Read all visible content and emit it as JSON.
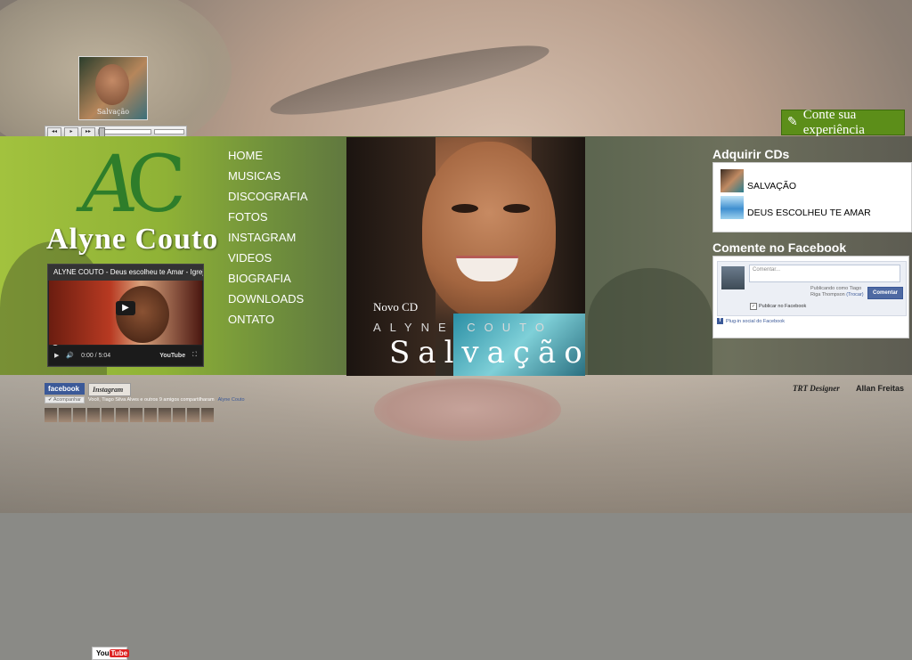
{
  "mini_player": {
    "cover_caption": "Salvação"
  },
  "experience_button": {
    "label": "Conte sua experiência",
    "icon": "pen-icon"
  },
  "logo": {
    "letters_a": "A",
    "letters_c": "C"
  },
  "brand": {
    "name": "Alyne Couto"
  },
  "youtube": {
    "title": "ALYNE COUTO - Deus escolheu te Amar - Igreja C",
    "time": "0:00 / 5:04",
    "logo": "YouTube",
    "progress": 0
  },
  "menu": {
    "items": [
      "HOME",
      "MUSICAS",
      "DISCOGRAFIA",
      "FOTOS",
      "INSTAGRAM",
      "VIDEOS",
      "BIOGRAFIA",
      "DOWNLOADS",
      "ONTATO"
    ]
  },
  "album": {
    "novo": "Novo CD",
    "artist": "ALYNE COUTO",
    "title": "Salvação"
  },
  "sidebar": {
    "cds_title": "Adquirir CDs",
    "cds": [
      "SALVAÇÃO",
      "DEUS ESCOLHEU TE AMAR"
    ],
    "facebook_title": "Comente no Facebook",
    "fb_placeholder": "Comentar...",
    "fb_publishing": "Publicando como Tiago Riga Thompson",
    "fb_change": "(Trocar)",
    "fb_button": "Comentar",
    "fb_checkbox": "Publicar no Facebook",
    "fb_plugin": "Plug-in social do Facebook"
  },
  "footer": {
    "facebook": "facebook",
    "instagram": "Instagram",
    "youtube_you": "You",
    "youtube_tube": "Tube",
    "follow_button": "✔ Acompanhar",
    "share_text": "Você, Tiago Silva Alves e outros 9 amigos compartilharam",
    "share_link": "Alyne Couto",
    "credit_trt": "TRT Designer",
    "credit_allan": "Allan Freitas"
  },
  "colors": {
    "green_accent": "#5c8e19",
    "facebook_blue": "#3b5998",
    "logo_green": "#2e7d2a"
  }
}
